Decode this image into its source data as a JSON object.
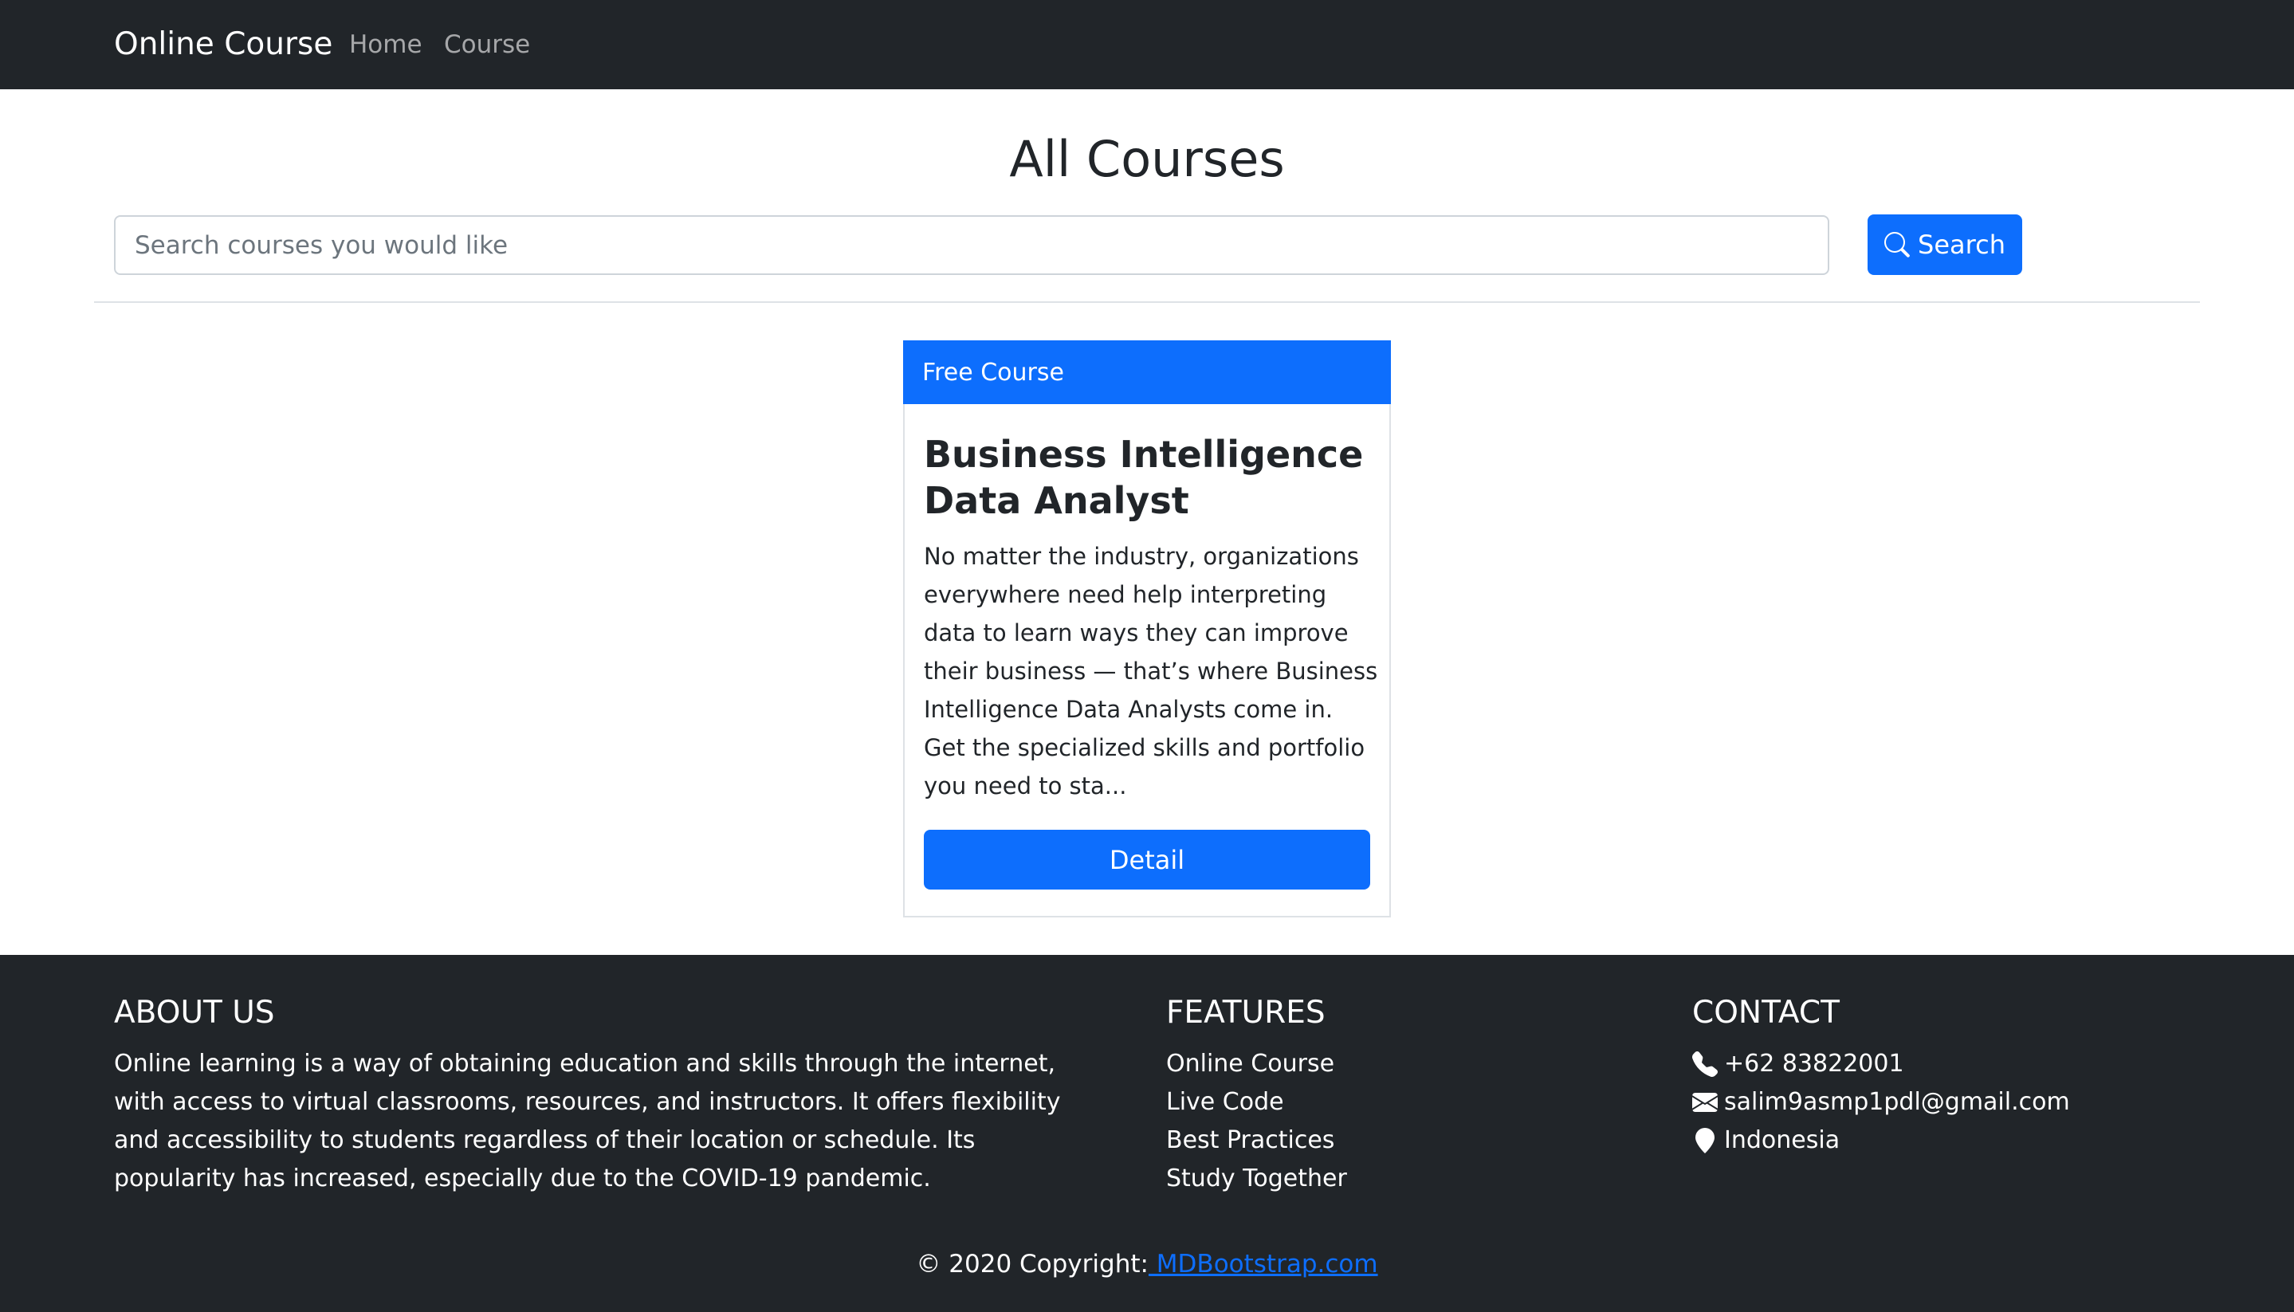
{
  "navbar": {
    "brand": "Online Course",
    "links": [
      {
        "label": "Home"
      },
      {
        "label": "Course"
      }
    ]
  },
  "main": {
    "title": "All Courses",
    "search": {
      "placeholder": "Search courses you would like",
      "value": "",
      "button_label": "Search",
      "button_icon": "search-icon"
    },
    "courses": [
      {
        "badge": "Free Course",
        "title": "Business Intelligence Data Analyst",
        "description": "No matter the industry, organizations everywhere need help interpreting data to learn ways they can improve their business — that’s where Business Intelligence Data Analysts come in. Get the specialized skills and portfolio you need to sta...",
        "button_label": "Detail"
      }
    ]
  },
  "footer": {
    "about": {
      "title": "ABOUT US",
      "text": "Online learning is a way of obtaining education and skills through the internet, with access to virtual classrooms, resources, and instructors. It offers flexibility and accessibility to students regardless of their location or schedule. Its popularity has increased, especially due to the COVID-19 pandemic."
    },
    "features": {
      "title": "FEATURES",
      "items": [
        "Online Course",
        "Live Code",
        "Best Practices",
        "Study Together"
      ]
    },
    "contact": {
      "title": "CONTACT",
      "items": [
        {
          "icon": "phone-icon",
          "text": "+62 83822001"
        },
        {
          "icon": "envelope-icon",
          "text": "salim9asmp1pdl@gmail.com"
        },
        {
          "icon": "map-marker-icon",
          "text": "Indonesia"
        }
      ]
    },
    "copyright": {
      "text": "© 2020 Copyright:",
      "link_label": " MDBootstrap.com"
    }
  },
  "colors": {
    "navbar_bg": "#212529",
    "primary": "#0d6efd",
    "footer_bg": "#212529"
  }
}
